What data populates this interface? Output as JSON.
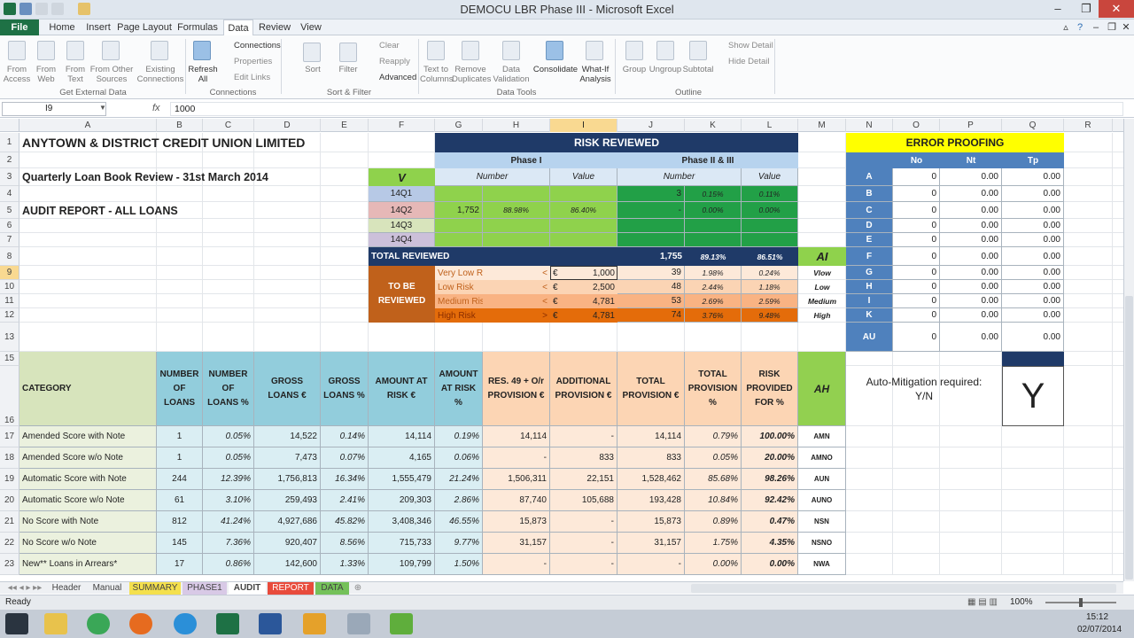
{
  "window": {
    "title": "DEMOCU LBR Phase III  -  Microsoft Excel"
  },
  "ribbon_tabs": [
    "File",
    "Home",
    "Insert",
    "Page Layout",
    "Formulas",
    "Data",
    "Review",
    "View"
  ],
  "ribbon": {
    "from_access": "From Access",
    "from_web": "From Web",
    "from_text": "From Text",
    "from_other": "From Other Sources",
    "existing_connections": "Existing Connections",
    "group_get_external": "Get External Data",
    "refresh_all": "Refresh All",
    "connections": "Connections",
    "properties": "Properties",
    "edit_links": "Edit Links",
    "group_connections": "Connections",
    "sort": "Sort",
    "filter": "Filter",
    "clear": "Clear",
    "reapply": "Reapply",
    "advanced": "Advanced",
    "group_sort_filter": "Sort & Filter",
    "text_to_columns": "Text to Columns",
    "remove_duplicates": "Remove Duplicates",
    "data_validation": "Data Validation",
    "consolidate": "Consolidate",
    "what_if": "What-If Analysis",
    "group_data_tools": "Data Tools",
    "group_btn": "Group",
    "ungroup": "Ungroup",
    "subtotal": "Subtotal",
    "show_detail": "Show Detail",
    "hide_detail": "Hide Detail",
    "group_outline": "Outline"
  },
  "formula_bar": {
    "name_box": "I9",
    "fx": "fx",
    "value": "1000"
  },
  "columns": [
    "A",
    "B",
    "C",
    "D",
    "E",
    "F",
    "G",
    "H",
    "I",
    "J",
    "K",
    "L",
    "M",
    "N",
    "O",
    "P",
    "Q",
    "R"
  ],
  "rows": [
    "1",
    "2",
    "3",
    "4",
    "5",
    "6",
    "7",
    "8",
    "9",
    "10",
    "11",
    "12",
    "13",
    "15",
    "16",
    "17",
    "18",
    "19",
    "20",
    "21",
    "22",
    "23"
  ],
  "header": {
    "org_name": "ANYTOWN & DISTRICT CREDIT UNION LIMITED",
    "review_title": "Quarterly Loan Book Review - 31st March 2014",
    "report_title": "AUDIT REPORT - ALL LOANS"
  },
  "risk": {
    "title": "RISK REVIEWED",
    "phase1": "Phase I",
    "phase23": "Phase II & III",
    "number": "Number",
    "value": "Value",
    "v": "V",
    "quarters": [
      {
        "q": "14Q1",
        "p1n": "",
        "p1p": "",
        "p1v": "",
        "p2n": "3",
        "p2p": "0.15%",
        "p2v": "0.11%"
      },
      {
        "q": "14Q2",
        "p1n": "1,752",
        "p1p": "88.98%",
        "p1v": "86.40%",
        "p2n": "-",
        "p2p": "0.00%",
        "p2v": "0.00%"
      },
      {
        "q": "14Q3",
        "p1n": "",
        "p1p": "",
        "p1v": "",
        "p2n": "",
        "p2p": "",
        "p2v": ""
      },
      {
        "q": "14Q4",
        "p1n": "",
        "p1p": "",
        "p1v": "",
        "p2n": "",
        "p2p": "",
        "p2v": ""
      }
    ],
    "total_label": "TOTAL REVIEWED",
    "total_n": "1,755",
    "total_p": "89.13%",
    "total_v": "86.51%",
    "ai": "AI",
    "to_be_reviewed": "TO BE REVIEWED",
    "levels": [
      {
        "name": "Very Low Risk",
        "op": "<",
        "cur": "€",
        "amt": "1,000",
        "n": "39",
        "p": "1.98%",
        "v": "0.24%",
        "code": "Vlow"
      },
      {
        "name": "Low Risk",
        "op": "<",
        "cur": "€",
        "amt": "2,500",
        "n": "48",
        "p": "2.44%",
        "v": "1.18%",
        "code": "Low"
      },
      {
        "name": "Medium Risk",
        "op": "<",
        "cur": "€",
        "amt": "4,781",
        "n": "53",
        "p": "2.69%",
        "v": "2.59%",
        "code": "Medium"
      },
      {
        "name": "High Risk",
        "op": ">",
        "cur": "€",
        "amt": "4,781",
        "n": "74",
        "p": "3.76%",
        "v": "9.48%",
        "code": "High"
      }
    ]
  },
  "error_proofing": {
    "title": "ERROR PROOFING",
    "cols": [
      "No",
      "Nt",
      "Tp"
    ],
    "rows": [
      {
        "k": "A",
        "no": "0",
        "nt": "0.00",
        "tp": "0.00"
      },
      {
        "k": "B",
        "no": "0",
        "nt": "0.00",
        "tp": "0.00"
      },
      {
        "k": "C",
        "no": "0",
        "nt": "0.00",
        "tp": "0.00"
      },
      {
        "k": "D",
        "no": "0",
        "nt": "0.00",
        "tp": "0.00"
      },
      {
        "k": "E",
        "no": "0",
        "nt": "0.00",
        "tp": "0.00"
      },
      {
        "k": "F",
        "no": "0",
        "nt": "0.00",
        "tp": "0.00"
      },
      {
        "k": "G",
        "no": "0",
        "nt": "0.00",
        "tp": "0.00"
      },
      {
        "k": "H",
        "no": "0",
        "nt": "0.00",
        "tp": "0.00"
      },
      {
        "k": "I",
        "no": "0",
        "nt": "0.00",
        "tp": "0.00"
      },
      {
        "k": "K",
        "no": "0",
        "nt": "0.00",
        "tp": "0.00"
      },
      {
        "k": "AU",
        "no": "0",
        "nt": "0.00",
        "tp": "0.00"
      }
    ]
  },
  "auto_mitigation": {
    "label": "Auto-Mitigation required:  Y/N",
    "value": "Y"
  },
  "table": {
    "headers": [
      "CATEGORY",
      "NUMBER OF LOANS",
      "NUMBER OF LOANS %",
      "GROSS LOANS €",
      "GROSS LOANS %",
      "AMOUNT AT RISK €",
      "AMOUNT AT RISK %",
      "RES. 49 + O/r PROVISION €",
      "ADDITIONAL PROVISION €",
      "TOTAL PROVISION €",
      "TOTAL PROVISION %",
      "RISK PROVIDED FOR %",
      "AH"
    ],
    "rows": [
      [
        "Amended Score with Note",
        "1",
        "0.05%",
        "14,522",
        "0.14%",
        "14,114",
        "0.19%",
        "14,114",
        "-",
        "14,114",
        "0.79%",
        "100.00%",
        "AMN"
      ],
      [
        "Amended Score w/o Note",
        "1",
        "0.05%",
        "7,473",
        "0.07%",
        "4,165",
        "0.06%",
        "-",
        "833",
        "833",
        "0.05%",
        "20.00%",
        "AMNO"
      ],
      [
        "Automatic Score with Note",
        "244",
        "12.39%",
        "1,756,813",
        "16.34%",
        "1,555,479",
        "21.24%",
        "1,506,311",
        "22,151",
        "1,528,462",
        "85.68%",
        "98.26%",
        "AUN"
      ],
      [
        "Automatic Score w/o Note",
        "61",
        "3.10%",
        "259,493",
        "2.41%",
        "209,303",
        "2.86%",
        "87,740",
        "105,688",
        "193,428",
        "10.84%",
        "92.42%",
        "AUNO"
      ],
      [
        "No Score with Note",
        "812",
        "41.24%",
        "4,927,686",
        "45.82%",
        "3,408,346",
        "46.55%",
        "15,873",
        "-",
        "15,873",
        "0.89%",
        "0.47%",
        "NSN"
      ],
      [
        "No Score w/o Note",
        "145",
        "7.36%",
        "920,407",
        "8.56%",
        "715,733",
        "9.77%",
        "31,157",
        "-",
        "31,157",
        "1.75%",
        "4.35%",
        "NSNO"
      ],
      [
        "New** Loans in Arrears*",
        "17",
        "0.86%",
        "142,600",
        "1.33%",
        "109,799",
        "1.50%",
        "-",
        "-",
        "-",
        "0.00%",
        "0.00%",
        "NWA"
      ]
    ]
  },
  "sheet_tabs": [
    "Header",
    "Manual",
    "SUMMARY",
    "PHASE1",
    "AUDIT",
    "REPORT",
    "DATA"
  ],
  "status": {
    "ready": "Ready",
    "zoom": "100%"
  },
  "clock": {
    "time": "15:12",
    "date": "02/07/2014"
  }
}
